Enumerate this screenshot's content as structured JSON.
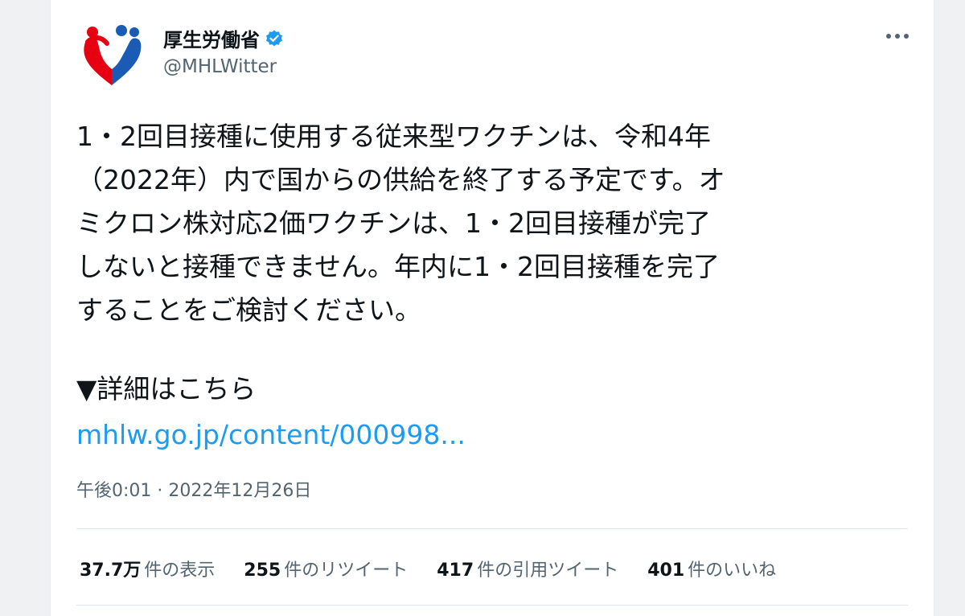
{
  "author": {
    "name": "厚生労働省",
    "handle": "@MHLWitter"
  },
  "tweet": {
    "text": "1・2回目接種に使用する従来型ワクチンは、令和4年\n（2022年）内で国からの供給を終了する予定です。オ\nミクロン株対応2価ワクチンは、1・2回目接種が完了\nしないと接種できません。年内に1・2回目接種を完了\nすることをご検討ください。",
    "detail_label": "▼詳細はこちら",
    "link": "mhlw.go.jp/content/000998...",
    "timestamp": "午後0:01 · 2022年12月26日"
  },
  "stats": [
    {
      "count": "37.7万",
      "label": "件の表示"
    },
    {
      "count": "255",
      "label": "件のリツイート"
    },
    {
      "count": "417",
      "label": "件の引用ツイート"
    },
    {
      "count": "401",
      "label": "件のいいね"
    }
  ],
  "colors": {
    "link": "#1d9bf0",
    "verified": "#1d9bf0",
    "logo_red": "#e60012",
    "logo_blue": "#1a5bb5"
  },
  "icons": {
    "avatar": "mhlw-logo",
    "verified": "verified-badge-icon",
    "more": "more-options-icon"
  }
}
